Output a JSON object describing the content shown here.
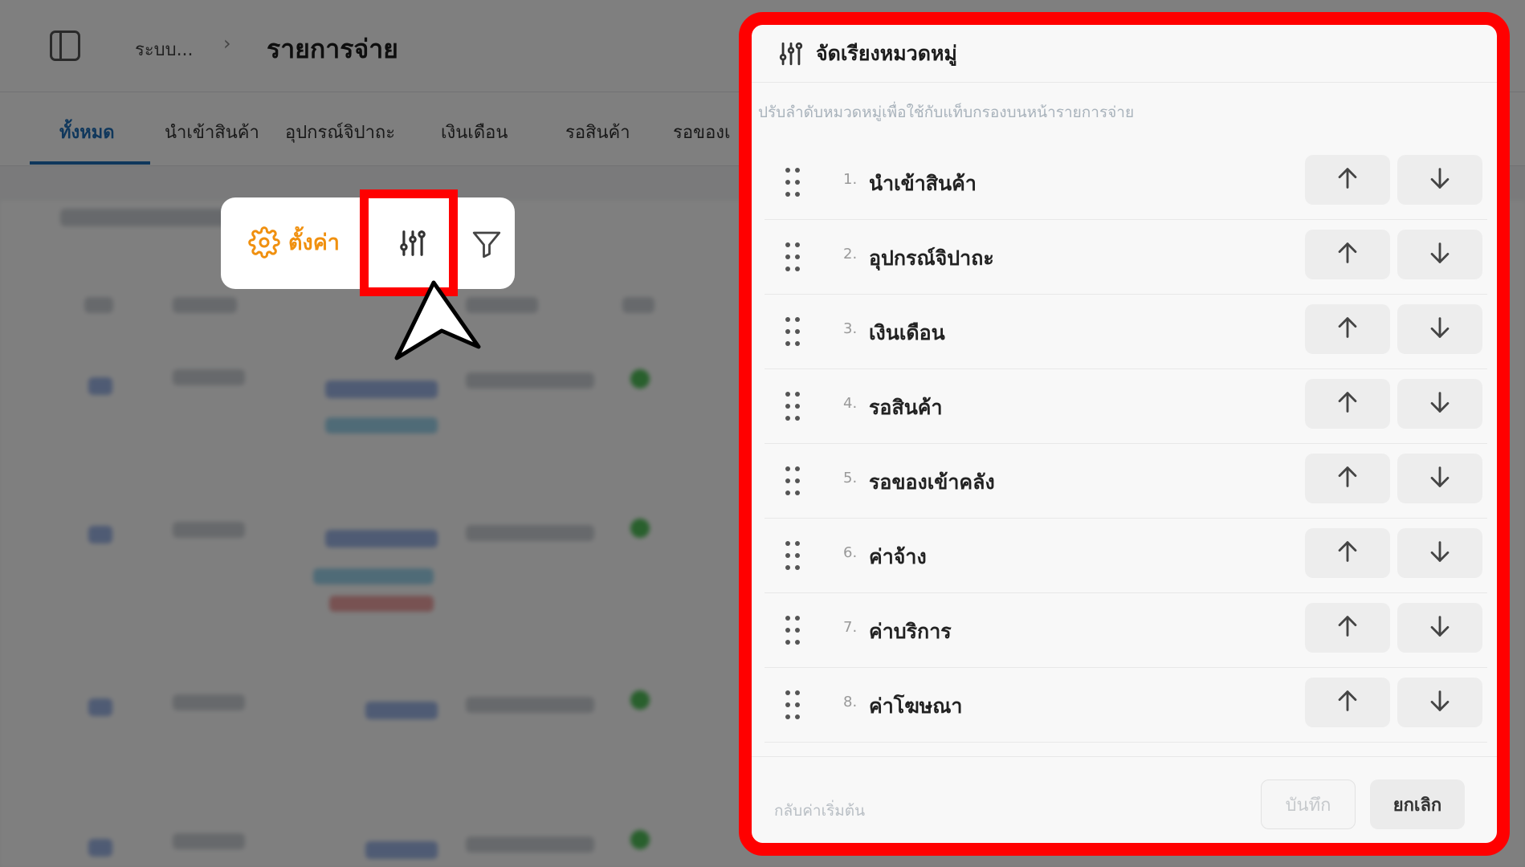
{
  "breadcrumb": {
    "root": "ระบบ...",
    "separator": "›",
    "current": "รายการจ่าย"
  },
  "tabs": [
    {
      "label": "ทั้งหมด",
      "active": true
    },
    {
      "label": "นำเข้าสินค้า"
    },
    {
      "label": "อุปกรณ์จิปาถะ"
    },
    {
      "label": "เงินเดือน"
    },
    {
      "label": "รอสินค้า"
    },
    {
      "label": "รอของเ"
    }
  ],
  "toolbar": {
    "settings_label": "ตั้งค่า",
    "settings_icon": "gear-icon",
    "sort_icon": "sliders-icon",
    "filter_icon": "filter-icon"
  },
  "panel": {
    "title": "จัดเรียงหมวดหมู่",
    "description": "ปรับลำดับหมวดหมู่เพื่อใช้กับแท็บกรองบนหน้ารายการจ่าย",
    "items": [
      {
        "num": "1.",
        "label": "นำเข้าสินค้า"
      },
      {
        "num": "2.",
        "label": "อุปกรณ์จิปาถะ"
      },
      {
        "num": "3.",
        "label": "เงินเดือน"
      },
      {
        "num": "4.",
        "label": "รอสินค้า"
      },
      {
        "num": "5.",
        "label": "รอของเข้าคลัง"
      },
      {
        "num": "6.",
        "label": "ค่าจ้าง"
      },
      {
        "num": "7.",
        "label": "ค่าบริการ"
      },
      {
        "num": "8.",
        "label": "ค่าโฆษณา"
      }
    ],
    "reset_label": "กลับค่าเริ่มต้น",
    "save_label": "บันทึก",
    "cancel_label": "ยกเลิก"
  },
  "colors": {
    "highlight": "#ff0000",
    "accent_orange": "#f0900f",
    "tab_active": "#1e6fb8"
  }
}
